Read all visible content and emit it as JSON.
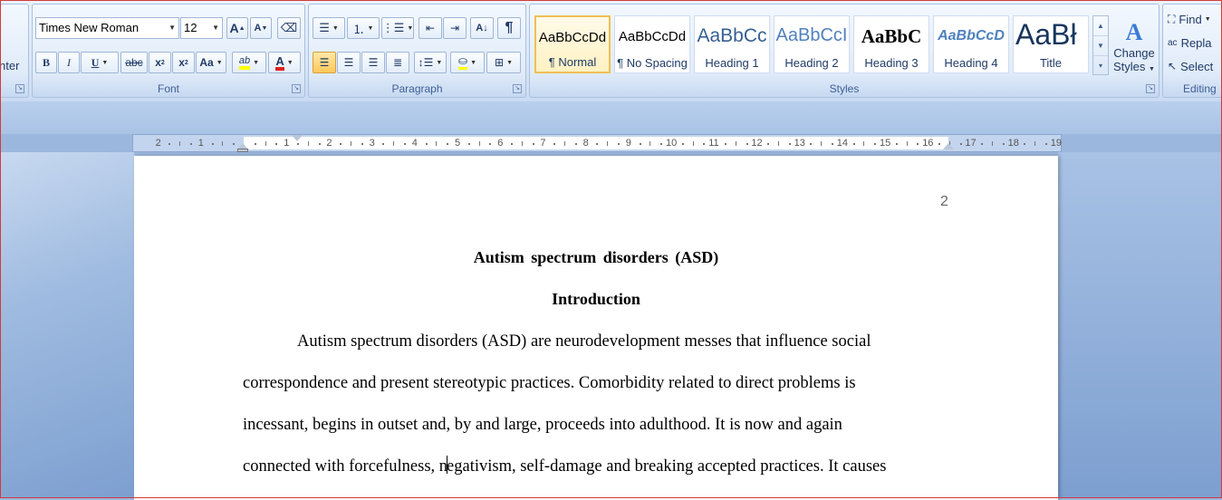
{
  "ribbon": {
    "clipboard": {
      "partial_label": "nter"
    },
    "font": {
      "label": "Font",
      "font_name": "Times New Roman",
      "font_size": "12",
      "grow_glyph": "A",
      "shrink_glyph": "A",
      "bold": "B",
      "italic": "I",
      "underline": "U",
      "strikethrough": "abc",
      "subscript": "x",
      "superscript": "x",
      "change_case": "Aa",
      "highlight": "ab",
      "font_color": "A",
      "highlight_color": "#ffff00",
      "font_color_value": "#e02020"
    },
    "paragraph": {
      "label": "Paragraph",
      "show_marks": "¶"
    },
    "styles": {
      "label": "Styles",
      "items": [
        {
          "sample": "AaBbCcDd",
          "name": "¶ Normal",
          "selected": true
        },
        {
          "sample": "AaBbCcDd",
          "name": "¶ No Spacing"
        },
        {
          "sample": "AaBbCc",
          "name": "Heading 1"
        },
        {
          "sample": "AaBbCcI",
          "name": "Heading 2"
        },
        {
          "sample": "AaBbC",
          "name": "Heading 3"
        },
        {
          "sample": "AaBbCcD",
          "name": "Heading 4"
        },
        {
          "sample": "AaBł",
          "name": "Title"
        }
      ],
      "change_styles_line1": "Change",
      "change_styles_line2": "Styles"
    },
    "editing": {
      "label": "Editing",
      "find": "Find",
      "replace": "Repla",
      "select": "Select"
    }
  },
  "ruler": {
    "left_numbers": [
      "2",
      "1"
    ],
    "right_numbers": [
      "1",
      "2",
      "3",
      "4",
      "5",
      "6",
      "7",
      "8",
      "9",
      "10",
      "11",
      "12",
      "13",
      "14",
      "15",
      "16",
      "17",
      "18",
      "19"
    ]
  },
  "document": {
    "page_number": "2",
    "title": "Autism spectrum disorders (ASD)",
    "subtitle": "Introduction",
    "lines": [
      "Autism spectrum disorders (ASD)  are neurodevelopment messes that influence social",
      "correspondence and present stereotypic practices. Comorbidity related to direct problems is",
      "incessant, begins in outset and, by and large, proceeds into adulthood. It is now and again",
      "connected with forcefulness, n",
      "egativism, self-damage and breaking accepted practices. It causes"
    ]
  }
}
